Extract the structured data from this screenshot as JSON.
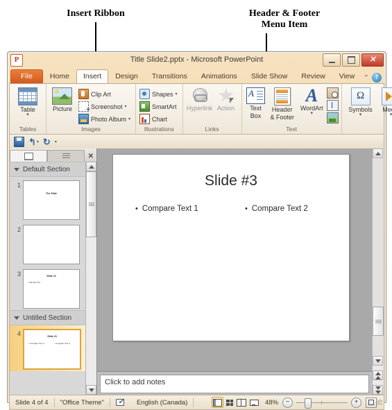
{
  "annotations": [
    {
      "text": "Insert Ribbon",
      "target": "insert-tab"
    },
    {
      "text": "Header & Footer\nMenu Item",
      "target": "header-footer-button"
    }
  ],
  "annotation_1_line": "Insert Ribbon",
  "annotation_2_line1": "Header & Footer",
  "annotation_2_line2": "Menu Item",
  "window": {
    "title": "Title Slide2.pptx  -  Microsoft PowerPoint",
    "app_logo": "P",
    "controls": {
      "minimize": "minimize-icon",
      "restore": "restore-icon",
      "close": "✕"
    }
  },
  "tabs": {
    "items": [
      {
        "label": "File",
        "active": false,
        "style": "file"
      },
      {
        "label": "Home",
        "active": false
      },
      {
        "label": "Insert",
        "active": true
      },
      {
        "label": "Design",
        "active": false
      },
      {
        "label": "Transitions",
        "active": false
      },
      {
        "label": "Animations",
        "active": false
      },
      {
        "label": "Slide Show",
        "active": false
      },
      {
        "label": "Review",
        "active": false
      },
      {
        "label": "View",
        "active": false
      }
    ],
    "minimize_ribbon": "⌃",
    "help": "?"
  },
  "ribbon": {
    "groups": [
      {
        "label": "Tables",
        "big": [
          {
            "label": "Table",
            "caret": "▾",
            "icon": "table-icon"
          }
        ]
      },
      {
        "label": "Images",
        "big": [
          {
            "label": "Picture",
            "caret": "",
            "icon": "picture-icon"
          }
        ],
        "small": [
          {
            "label": "Clip Art",
            "caret": "",
            "icon": "clip-art-icon"
          },
          {
            "label": "Screenshot",
            "caret": "▾",
            "icon": "screenshot-icon"
          },
          {
            "label": "Photo Album",
            "caret": "▾",
            "icon": "photo-album-icon"
          }
        ]
      },
      {
        "label": "Illustrations",
        "small": [
          {
            "label": "Shapes",
            "caret": "▾",
            "icon": "shapes-icon"
          },
          {
            "label": "SmartArt",
            "caret": "",
            "icon": "smartart-icon"
          },
          {
            "label": "Chart",
            "caret": "",
            "icon": "chart-icon"
          }
        ]
      },
      {
        "label": "Links",
        "big": [
          {
            "label": "Hyperlink",
            "caret": "",
            "icon": "hyperlink-icon"
          },
          {
            "label": "Action",
            "caret": "",
            "icon": "action-icon"
          }
        ]
      },
      {
        "label": "Text",
        "big": [
          {
            "label": "Text\nBox",
            "line1": "Text",
            "line2": "Box",
            "caret": "",
            "icon": "text-box-icon"
          },
          {
            "label": "Header\n& Footer",
            "line1": "Header",
            "line2": "& Footer",
            "caret": "",
            "icon": "header-footer-icon"
          },
          {
            "label": "WordArt",
            "line1": "WordArt",
            "line2": "",
            "caret": "▾",
            "icon": "wordart-icon"
          }
        ],
        "tiny": [
          "date-time-icon",
          "slide-number-icon",
          "object-icon"
        ]
      },
      {
        "label": "",
        "big": [
          {
            "label": "Symbols",
            "caret": "▾",
            "icon": "symbol-icon",
            "glyph": "Ω"
          },
          {
            "label": "Media",
            "caret": "▾",
            "icon": "media-icon"
          }
        ]
      }
    ]
  },
  "quick_access": {
    "items": [
      {
        "name": "save-icon",
        "caret": ""
      },
      {
        "name": "undo-icon",
        "glyph": "↰",
        "caret": "▾"
      },
      {
        "name": "redo-icon",
        "glyph": "↻",
        "caret": ""
      },
      {
        "name": "customize-qat-icon",
        "glyph": "▾",
        "caret": ""
      }
    ]
  },
  "slide_panel": {
    "tab_slides": "slides-tab",
    "tab_outline": "outline-tab",
    "close": "✕",
    "sections": [
      {
        "name": "Default Section",
        "slides": [
          {
            "number": "1",
            "title": "The Slide",
            "bullets": [],
            "selected": false
          },
          {
            "number": "2",
            "title": "",
            "bullets": [],
            "selected": false
          },
          {
            "number": "3",
            "title": "Slide #2",
            "bullets": [
              "Sample Text"
            ],
            "selected": false
          }
        ]
      },
      {
        "name": "Untitled Section",
        "slides": [
          {
            "number": "4",
            "title": "Slide #3",
            "bullets": [
              "Compare Text 1",
              "Compare Text 2"
            ],
            "selected": true
          }
        ]
      }
    ]
  },
  "slide": {
    "title": "Slide #3",
    "bullet_char": "•",
    "left_text": "Compare Text 1",
    "right_text": "Compare Text 2"
  },
  "notes": {
    "placeholder": "Click to add notes"
  },
  "status_bar": {
    "slide_counter": "Slide 4 of 4",
    "theme": "\"Office Theme\"",
    "spell_icon": "spell-check-icon",
    "language": "English (Canada)",
    "views": [
      {
        "name": "normal-view-button",
        "active": true
      },
      {
        "name": "slide-sorter-view-button",
        "active": false
      },
      {
        "name": "reading-view-button",
        "active": false
      },
      {
        "name": "slide-show-view-button",
        "active": false
      }
    ],
    "zoom_level": "48%",
    "zoom_out": "−",
    "zoom_in": "+",
    "fit_button": "fit-slide-to-window-icon"
  },
  "colors": {
    "accent_orange": "#d4581e",
    "titlebar": "#f3d9ab",
    "workspace": "#a9a9a9",
    "selection": "#e0a33a"
  }
}
